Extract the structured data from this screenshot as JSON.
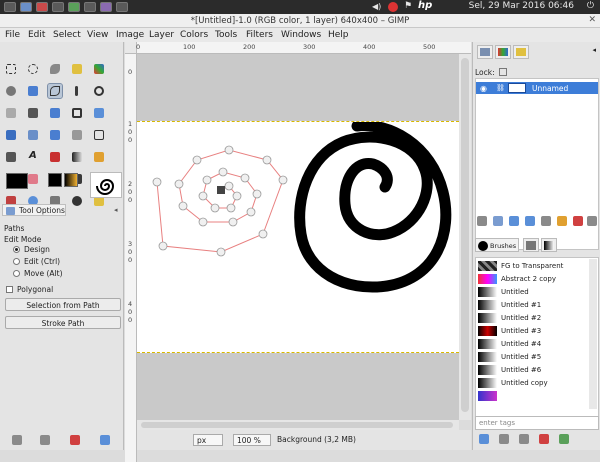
{
  "system": {
    "clock": "Sel, 29 Mar 2016 06:46",
    "logo": "hp"
  },
  "window": {
    "title": "*[Untitled]-1.0 (RGB color, 1 layer) 640x400 – GIMP"
  },
  "menu": [
    "File",
    "Edit",
    "Select",
    "View",
    "Image",
    "Layer",
    "Colors",
    "Tools",
    "Filters",
    "Windows",
    "Help"
  ],
  "tool_options": {
    "tab_label": "Tool Options",
    "section": "Paths",
    "edit_mode_label": "Edit Mode",
    "modes": [
      {
        "label": "Design",
        "selected": true
      },
      {
        "label": "Edit (Ctrl)",
        "selected": false
      },
      {
        "label": "Move (Alt)",
        "selected": false
      }
    ],
    "polygonal_label": "Polygonal",
    "selection_button": "Selection from Path",
    "stroke_button": "Stroke Path"
  },
  "rulers": {
    "h_ticks": [
      "0",
      "100",
      "200",
      "300",
      "400",
      "500"
    ],
    "v_ticks": [
      "0",
      "1",
      "0",
      "0",
      "2",
      "0",
      "0",
      "3",
      "0",
      "0",
      "4",
      "0",
      "0"
    ]
  },
  "status": {
    "unit": "px",
    "zoom": "100 %",
    "layer_info": "Background (3,2 MB)"
  },
  "layers": {
    "lock_label": "Lock:",
    "layer_name": "Unnamed"
  },
  "brushes": {
    "tab_label": "Brushes",
    "items": [
      {
        "name": "FG to Transparent"
      },
      {
        "name": "Abstract 2 copy"
      },
      {
        "name": "Untitled"
      },
      {
        "name": "Untitled #1"
      },
      {
        "name": "Untitled #2"
      },
      {
        "name": "Untitled #3"
      },
      {
        "name": "Untitled #4"
      },
      {
        "name": "Untitled #5"
      },
      {
        "name": "Untitled #6"
      },
      {
        "name": "Untitled copy"
      }
    ],
    "tag_placeholder": "enter tags"
  },
  "colors": {
    "path_stroke": "#e88080",
    "selected_layer": "#3d7dd8",
    "marching_ants": "#d8b800"
  }
}
